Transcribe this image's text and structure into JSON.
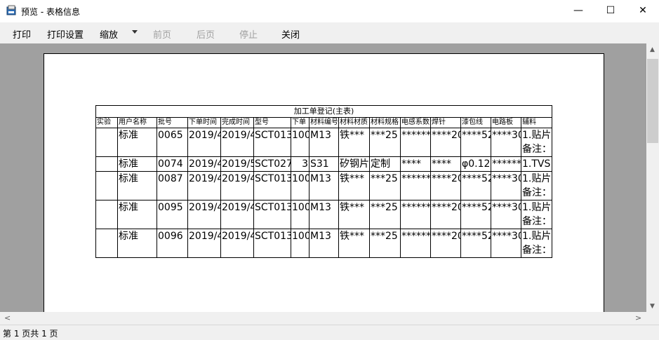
{
  "window": {
    "title": "预览 - 表格信息",
    "minimize": "—",
    "maximize": "☐",
    "close": "✕"
  },
  "toolbar": {
    "print": "打印",
    "print_settings": "打印设置",
    "zoom": "缩放",
    "prev_page": "前页",
    "next_page": "后页",
    "stop": "停止",
    "close": "关闭"
  },
  "report": {
    "title": "加工单登记(主表)",
    "headers": [
      "实验",
      "用户名称",
      "批号",
      "下单时间",
      "完成时间",
      "型号",
      "下单",
      "材料编号",
      "材料材质",
      "材料规格",
      "电感系数",
      "焊针",
      "漆包线",
      "电路板",
      "辅料"
    ],
    "rows": [
      [
        "",
        "标准",
        "0065",
        "2019/4",
        "2019/4",
        "SCT013",
        "100",
        "M13",
        "铁***",
        "***25",
        "******",
        "****20",
        "****52",
        "****30",
        "1.贴片\n备注："
      ],
      [
        "",
        "标准",
        "0074",
        "2019/4",
        "2019/5",
        "SCT027",
        "3",
        "S31",
        "矽钢片",
        "定制",
        "****",
        "****",
        "φ0.12",
        "******",
        "1.TVS"
      ],
      [
        "",
        "标准",
        "0087",
        "2019/4",
        "2019/4",
        "SCT013",
        "100",
        "M13",
        "铁***",
        "***25",
        "******",
        "****20",
        "****52",
        "****30",
        "1.贴片\n备注："
      ],
      [
        "",
        "标准",
        "0095",
        "2019/4",
        "2019/4",
        "SCT013",
        "100",
        "M13",
        "铁***",
        "***25",
        "******",
        "****20",
        "****52",
        "****30",
        "1.贴片\n备注："
      ],
      [
        "",
        "标准",
        "0096",
        "2019/4",
        "2019/4",
        "SCT013",
        "100",
        "M13",
        "铁***",
        "***25",
        "******",
        "****20",
        "****52",
        "****30",
        "1.贴片\n备注："
      ]
    ]
  },
  "status": {
    "text": "第 1 页共 1 页"
  },
  "scroll": {
    "left": "<",
    "right": ">",
    "up": "▲",
    "down": "▼"
  }
}
